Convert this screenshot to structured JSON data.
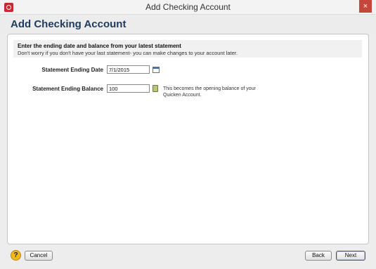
{
  "window": {
    "title": "Add Checking Account",
    "close_glyph": "×"
  },
  "page": {
    "title": "Add Checking Account"
  },
  "instructions": {
    "heading": "Enter the ending date and balance from your latest statement",
    "subtext": "Don't worry if you don't have your last statement- you can make changes to your account later."
  },
  "form": {
    "ending_date": {
      "label": "Statement Ending Date",
      "value": "7/1/2015",
      "icon": "calendar-icon"
    },
    "ending_balance": {
      "label": "Statement Ending Balance",
      "value": "100",
      "icon": "calculator-icon",
      "hint": "This becomes the opening balance of your Quicken Account."
    }
  },
  "footer": {
    "help_glyph": "?",
    "cancel_label": "Cancel",
    "back_label": "Back",
    "next_label": "Next"
  },
  "colors": {
    "title_text": "#1f3a5c",
    "close_button": "#c7463c",
    "help_button": "#f0b820",
    "app_icon": "#c8282e"
  }
}
